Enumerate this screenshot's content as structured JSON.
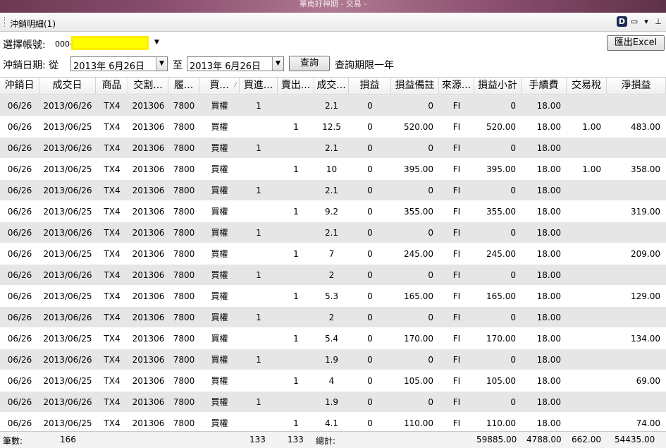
{
  "window": {
    "title": "華南好神期 - 交易 -"
  },
  "panel": {
    "title": "沖銷明細(1)",
    "icons": [
      "d-app-icon",
      "window-icon",
      "dropdown-icon",
      "pin-icon"
    ]
  },
  "account": {
    "label": "選擇帳號:",
    "prefix": "000-"
  },
  "export": {
    "label": "匯出Excel"
  },
  "date_filter": {
    "label": "沖銷日期: 從",
    "from": "2013年  6月26日",
    "to_label": "至",
    "to": "2013年  6月26日",
    "query_label": "查詢",
    "limit_note": "查詢期限一年"
  },
  "table": {
    "headers": [
      "沖銷日",
      "成交日",
      "商品",
      "交割...",
      "履...",
      "買...",
      "買進...",
      "賣出...",
      "成交...",
      "損益",
      "損益備註",
      "來源...",
      "損益小計",
      "手續費",
      "交易稅",
      "淨損益"
    ],
    "rows": [
      [
        "06/26",
        "2013/06/26",
        "TX4",
        "201306",
        "7800",
        "買權",
        "1",
        "",
        "2.1",
        "0",
        "0",
        "FI",
        "0",
        "18.00",
        "",
        ""
      ],
      [
        "06/26",
        "2013/06/25",
        "TX4",
        "201306",
        "7800",
        "買權",
        "",
        "1",
        "12.5",
        "0",
        "520.00",
        "FI",
        "520.00",
        "18.00",
        "1.00",
        "483.00"
      ],
      [
        "06/26",
        "2013/06/26",
        "TX4",
        "201306",
        "7800",
        "買權",
        "1",
        "",
        "2.1",
        "0",
        "0",
        "FI",
        "0",
        "18.00",
        "",
        ""
      ],
      [
        "06/26",
        "2013/06/25",
        "TX4",
        "201306",
        "7800",
        "買權",
        "",
        "1",
        "10",
        "0",
        "395.00",
        "FI",
        "395.00",
        "18.00",
        "1.00",
        "358.00"
      ],
      [
        "06/26",
        "2013/06/26",
        "TX4",
        "201306",
        "7800",
        "買權",
        "1",
        "",
        "2.1",
        "0",
        "0",
        "FI",
        "0",
        "18.00",
        "",
        ""
      ],
      [
        "06/26",
        "2013/06/25",
        "TX4",
        "201306",
        "7800",
        "買權",
        "",
        "1",
        "9.2",
        "0",
        "355.00",
        "FI",
        "355.00",
        "18.00",
        "",
        "319.00"
      ],
      [
        "06/26",
        "2013/06/26",
        "TX4",
        "201306",
        "7800",
        "買權",
        "1",
        "",
        "2.1",
        "0",
        "0",
        "FI",
        "0",
        "18.00",
        "",
        ""
      ],
      [
        "06/26",
        "2013/06/25",
        "TX4",
        "201306",
        "7800",
        "買權",
        "",
        "1",
        "7",
        "0",
        "245.00",
        "FI",
        "245.00",
        "18.00",
        "",
        "209.00"
      ],
      [
        "06/26",
        "2013/06/26",
        "TX4",
        "201306",
        "7800",
        "買權",
        "1",
        "",
        "2",
        "0",
        "0",
        "FI",
        "0",
        "18.00",
        "",
        ""
      ],
      [
        "06/26",
        "2013/06/25",
        "TX4",
        "201306",
        "7800",
        "買權",
        "",
        "1",
        "5.3",
        "0",
        "165.00",
        "FI",
        "165.00",
        "18.00",
        "",
        "129.00"
      ],
      [
        "06/26",
        "2013/06/26",
        "TX4",
        "201306",
        "7800",
        "買權",
        "1",
        "",
        "2",
        "0",
        "0",
        "FI",
        "0",
        "18.00",
        "",
        ""
      ],
      [
        "06/26",
        "2013/06/25",
        "TX4",
        "201306",
        "7800",
        "買權",
        "",
        "1",
        "5.4",
        "0",
        "170.00",
        "FI",
        "170.00",
        "18.00",
        "",
        "134.00"
      ],
      [
        "06/26",
        "2013/06/26",
        "TX4",
        "201306",
        "7800",
        "買權",
        "1",
        "",
        "1.9",
        "0",
        "0",
        "FI",
        "0",
        "18.00",
        "",
        ""
      ],
      [
        "06/26",
        "2013/06/25",
        "TX4",
        "201306",
        "7800",
        "買權",
        "",
        "1",
        "4",
        "0",
        "105.00",
        "FI",
        "105.00",
        "18.00",
        "",
        "69.00"
      ],
      [
        "06/26",
        "2013/06/26",
        "TX4",
        "201306",
        "7800",
        "買權",
        "1",
        "",
        "1.9",
        "0",
        "0",
        "FI",
        "0",
        "18.00",
        "",
        ""
      ],
      [
        "06/26",
        "2013/06/25",
        "TX4",
        "201306",
        "7800",
        "買權",
        "",
        "1",
        "4.1",
        "0",
        "110.00",
        "FI",
        "110.00",
        "18.00",
        "",
        "74.00"
      ]
    ]
  },
  "footer": {
    "count_label": "筆數:",
    "count": "166",
    "buy_total": "133",
    "sell_total": "133",
    "total_label": "總計:",
    "pl_subtotal": "59885.00",
    "fee_total": "4788.00",
    "tax_total": "662.00",
    "net_total": "54435.00"
  },
  "colors": {
    "row_alt": "#e6e6e6",
    "account_highlight": "#ffff00"
  }
}
